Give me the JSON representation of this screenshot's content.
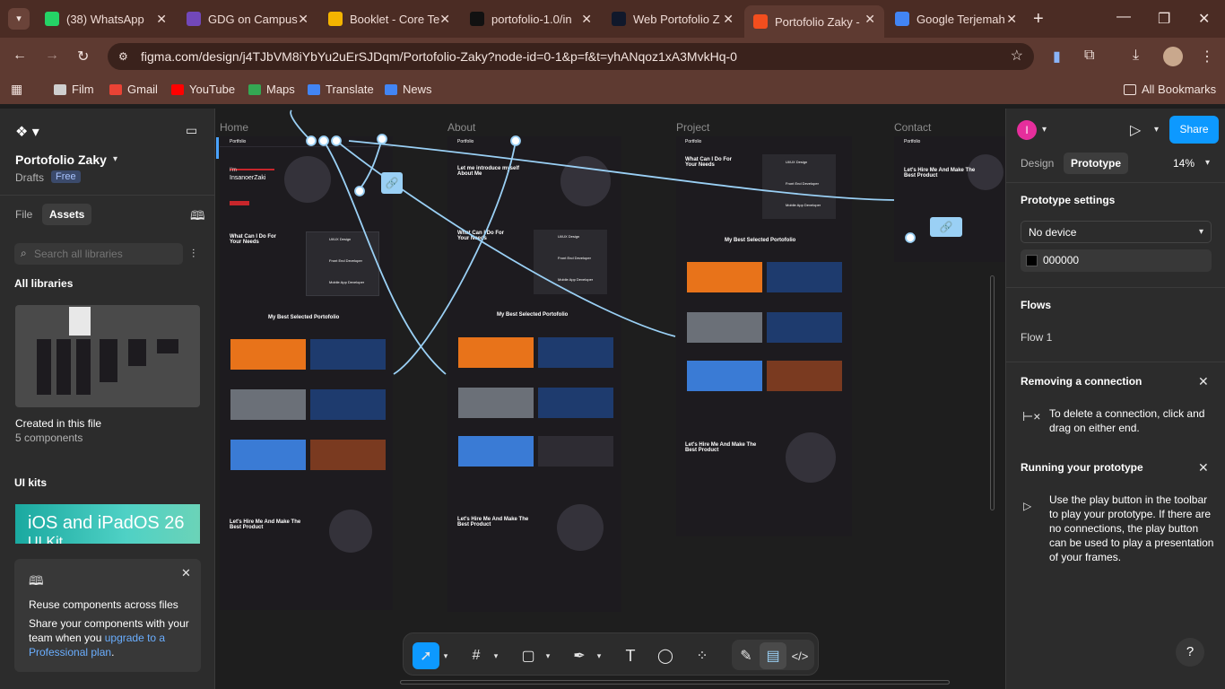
{
  "tabs": [
    {
      "label": "(38) WhatsApp",
      "icon": "whatsapp-icon",
      "color": "#25d366"
    },
    {
      "label": "GDG on Campus",
      "icon": "forms-icon",
      "color": "#7248b9"
    },
    {
      "label": "Booklet - Core Te",
      "icon": "slides-icon",
      "color": "#f4b400"
    },
    {
      "label": "portofolio-1.0/in",
      "icon": "github-icon",
      "color": "#111111"
    },
    {
      "label": "Web Portofolio Z",
      "icon": "pf-icon",
      "color": "#10182b"
    },
    {
      "label": "Portofolio Zaky -",
      "icon": "figma-icon",
      "color": "#f24e1e"
    },
    {
      "label": "Google Terjemah",
      "icon": "translate-icon",
      "color": "#4285f4"
    }
  ],
  "url": "figma.com/design/j4TJbVM8iYbYu2uErSJDqm/Portofolio-Zaky?node-id=0-1&p=f&t=yhANqoz1xA3MvkHq-0",
  "bookmarks": [
    {
      "label": "Film",
      "color": "#cfcfcf"
    },
    {
      "label": "Gmail",
      "color": "#ea4335"
    },
    {
      "label": "YouTube",
      "color": "#ff0000"
    },
    {
      "label": "Maps",
      "color": "#34a853"
    },
    {
      "label": "Translate",
      "color": "#4285f4"
    },
    {
      "label": "News",
      "color": "#4285f4"
    }
  ],
  "all_bookmarks": "All Bookmarks",
  "left": {
    "file_name": "Portofolio Zaky",
    "drafts": "Drafts",
    "plan_badge": "Free",
    "tab_file": "File",
    "tab_assets": "Assets",
    "search_placeholder": "Search all libraries",
    "all_libraries": "All libraries",
    "created_title": "Created in this file",
    "created_count": "5 components",
    "ui_kits": "UI kits",
    "kit_title": "iOS and iPadOS 26",
    "kit_sub": "UI Kit",
    "promo_title": "Reuse components across files",
    "promo_body": "Share your components with your team when you ",
    "promo_link": "upgrade to a Professional plan",
    "promo_end": "."
  },
  "canvas": {
    "frames": [
      "Home",
      "About",
      "Project",
      "Contact"
    ],
    "nav_brand": "Portfolio",
    "hero_greeting": "I'm",
    "hero_name": "InsanoerZaki",
    "about_title": "Let me introduce myself About Me",
    "services_title": "What Can I Do For Your Needs",
    "services": [
      "UI/UX Design",
      "Front End Developer",
      "Mobile App Developer"
    ],
    "portfolio_title": "My Best Selected Portofolio",
    "hire_title": "Let's Hire Me And Make The Best Product"
  },
  "right": {
    "avatar_letter": "I",
    "share": "Share",
    "tab_design": "Design",
    "tab_prototype": "Prototype",
    "zoom": "14%",
    "settings_title": "Prototype settings",
    "device": "No device",
    "bg_color": "000000",
    "flows_title": "Flows",
    "flow_1": "Flow 1",
    "remove_title": "Removing a connection",
    "remove_body": "To delete a connection, click and drag on either end.",
    "run_title": "Running your prototype",
    "run_body": "Use the play button in the toolbar to play your prototype. If there are no connections, the play button can be used to play a presentation of your frames."
  },
  "toolbar": [
    "move-tool",
    "frame-tool",
    "shape-tool",
    "pen-tool",
    "text-tool",
    "comment-tool",
    "actions-tool",
    "draw-mode",
    "design-mode",
    "dev-mode"
  ],
  "help": "?"
}
